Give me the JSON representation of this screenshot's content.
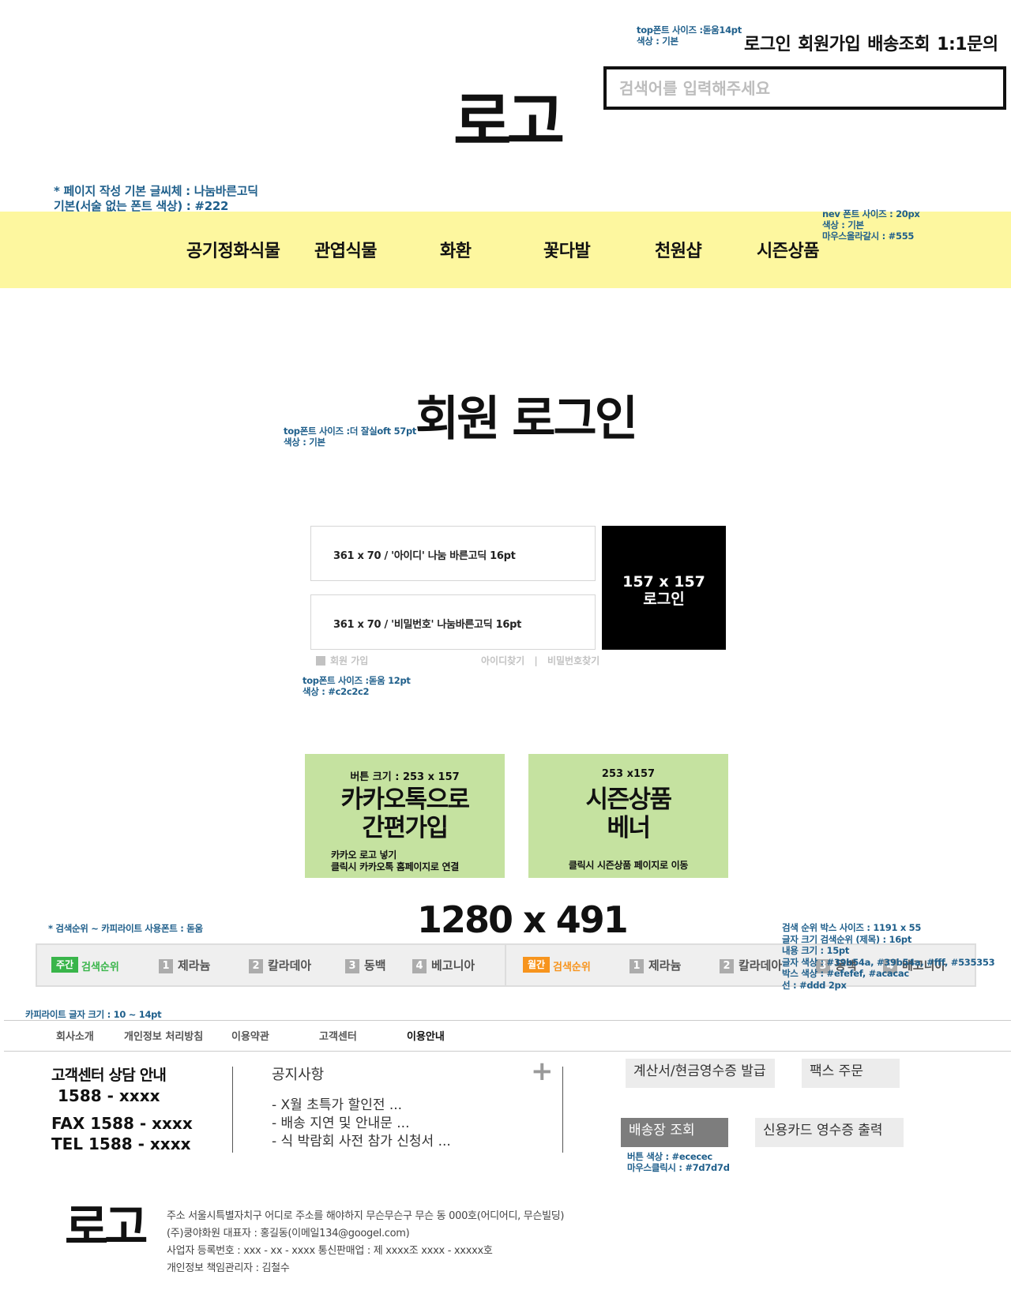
{
  "header": {
    "top_links": [
      "로그인",
      "회원가입",
      "배송조회",
      "1:1문의"
    ],
    "top_note": [
      "top폰트 사이즈 :돋움14pt",
      "색상 : 기본"
    ],
    "search_placeholder": "검색어를 입력해주세요",
    "logo": "로고",
    "page_note": [
      "* 페이지 작성 기본 글씨체 : 나눔바른고딕",
      "기본(서술 없는 폰트 색상) : #222"
    ]
  },
  "nav": {
    "items": [
      "공기정화식물",
      "관엽식물",
      "화환",
      "꽃다발",
      "천원샵",
      "시즌상품"
    ],
    "note": [
      "nev 폰트 사이즈 : 20px",
      "색상 : 기본",
      "마우스올라갈시 : #555"
    ],
    "bg_color": "#fdf79f"
  },
  "login": {
    "title": "회원 로그인",
    "title_note": [
      "top폰트 사이즈 :더 잘실oft 57pt",
      "색상 : 기본"
    ],
    "id_field": "361 x 70 / '아이디' 나눔 바른고딕 16pt",
    "pw_field": "361 x 70 / '비밀번호' 나눔바른고딕 16pt",
    "button": [
      "157 x 157",
      "로그인"
    ],
    "signup_link": "회원 가입",
    "find_id": "아이디찾기",
    "separator": "|",
    "find_pw": "비밀번호찾기",
    "links_note": [
      "top폰트 사이즈 :돋움 12pt",
      "색상 : #c2c2c2"
    ]
  },
  "banners": {
    "kakao": {
      "size": "버튼 크기 : 253 x 157",
      "title_lines": [
        "카카오톡으로",
        "간편가입"
      ],
      "desc_lines": [
        "카카오 로고 넣기",
        "클릭시 카카오톡 홈페이지로 연결"
      ]
    },
    "season": {
      "size": "253 x157",
      "title_lines": [
        "시즌상품",
        "베너"
      ],
      "desc": "클릭시 시즌상품 페이지로 이동"
    },
    "bg_color": "#c5e2a0",
    "size_label": "1280 x 491"
  },
  "ranking": {
    "note_left": "* 검색순위 ~ 카피라이트 사용폰트 : 돋움",
    "weekly": {
      "tag": "주간",
      "title": "검색순위",
      "items": [
        {
          "num": "1",
          "label": "제라늄"
        },
        {
          "num": "2",
          "label": "칼라데아"
        },
        {
          "num": "3",
          "label": "동백"
        },
        {
          "num": "4",
          "label": "베고니아"
        }
      ]
    },
    "monthly": {
      "tag": "월간",
      "title": "검색순위",
      "items": [
        {
          "num": "1",
          "label": "제라늄"
        },
        {
          "num": "2",
          "label": "칼라데아"
        },
        {
          "num": "3",
          "label": "동백"
        },
        {
          "num": "4",
          "label": "베고니아"
        }
      ]
    },
    "note_right": [
      "검색 순위 박스 사이즈 : 1191 x 55",
      "글자 크기 검색순위 (제목) : 16pt",
      "내용 크기 : 15pt",
      "글자 색상 : #39b54a, #39b54a, #fff, #535353",
      "박스 색상 : #efefef, #acacac",
      "선 : #ddd     2px"
    ],
    "colors": {
      "weekly_tag": "#39b54a",
      "monthly_tag": "#f7941d",
      "box": "#efefef",
      "num_box": "#acacac",
      "text": "#535353",
      "line": "#ddd"
    }
  },
  "footer": {
    "copyright_note": "카피라이트 글자 크기 : 10 ~ 14pt",
    "links": [
      "회사소개",
      "개인정보 처리방침",
      "이용약관",
      "고객센터",
      "이용안내"
    ],
    "cs": {
      "title": "고객센터 상담 안내",
      "phone": "1588 - xxxx",
      "fax": "FAX  1588 - xxxx",
      "tel": "TEL   1588 - xxxx"
    },
    "notice": {
      "title": "공지사항",
      "plus": "+",
      "items": [
        "- X월 초특가 할인전 ...",
        "- 배송 지연 및 안내문 ...",
        "- 식 박람회 사전 참가 신청서  ..."
      ]
    },
    "services": {
      "receipt": "계산서/현금영수증 발급",
      "fax_order": "팩스 주문",
      "delivery": "배송장 조회",
      "card_receipt": "신용카드 영수증 출력",
      "note": [
        "버튼 색상 : #ececec",
        "마우스클릭시 : #7d7d7d"
      ]
    },
    "logo": "로고",
    "info": [
      "주소 서울시특별자치구 어디로 주소를 해야하지 무슨무슨구  무슨 동  000호(어디어디, 무슨빌딩)",
      "(주)쿵야화원           대표자 : 홍길동(이메일134@googel.com)",
      "사업자 등록번호 : xxx - xx - xxxx         통신판매업 :   제 xxxx조  xxxx - xxxxx호",
      "개인정보 책임관리자 : 김철수"
    ]
  }
}
